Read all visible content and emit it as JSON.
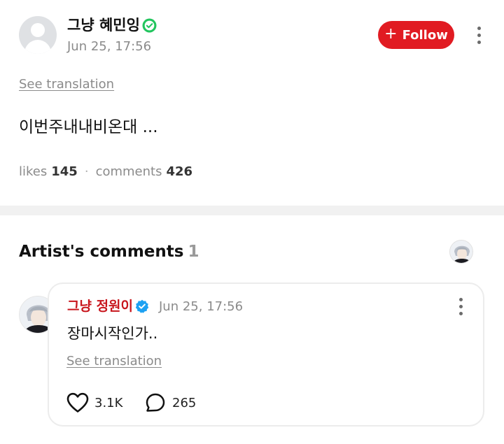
{
  "post": {
    "author_name": "그냥 혜민잉",
    "timestamp": "Jun 25, 17:56",
    "follow_label": "Follow",
    "see_translation": "See translation",
    "body": "이번주내내비온대 ...",
    "likes_label": "likes",
    "likes_count": "145",
    "stats_separator": "·",
    "comments_label": "comments",
    "comments_count": "426",
    "verified_color": "#22c55e",
    "follow_color": "#e11b22"
  },
  "artist_comments": {
    "title": "Artist's comments",
    "count": "1",
    "comment": {
      "author_name": "그냥 정원이",
      "timestamp": "Jun 25, 17:56",
      "body": "장마시작인가..",
      "see_translation": "See translation",
      "likes_count": "3.1K",
      "replies_count": "265",
      "author_color": "#c8161d",
      "verified_color": "#1da1f2"
    }
  },
  "icons": {
    "post_avatar": "default-user-icon",
    "post_verified": "verified-check-icon",
    "follow_plus": "plus-icon",
    "more": "more-vertical-icon",
    "like": "heart-outline-icon",
    "reply": "speech-bubble-icon",
    "artist_avatar": "artist-photo-avatar"
  }
}
